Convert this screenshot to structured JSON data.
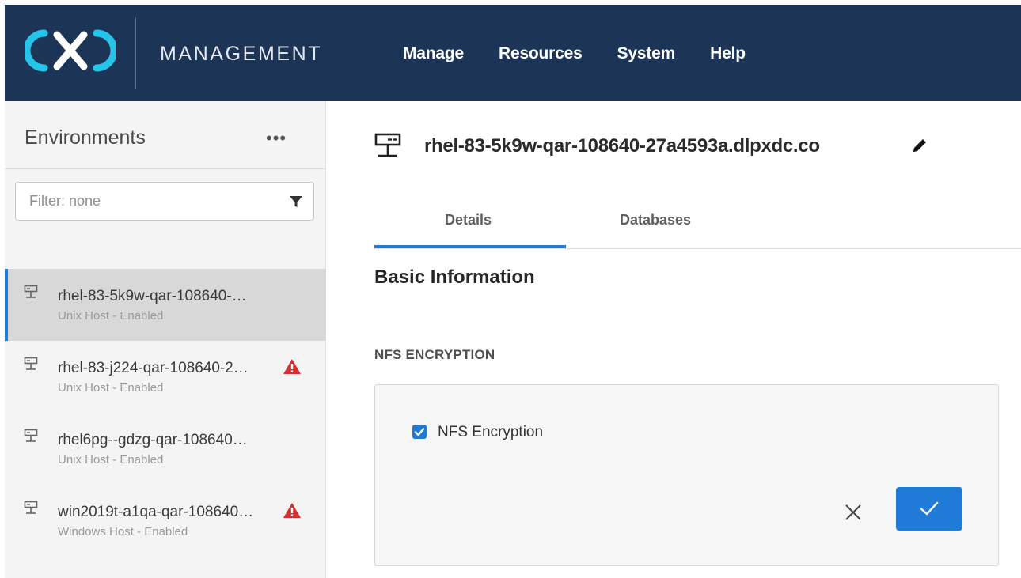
{
  "header": {
    "brand": "MANAGEMENT",
    "nav": [
      "Manage",
      "Resources",
      "System",
      "Help"
    ]
  },
  "sidebar": {
    "title": "Environments",
    "more": "•••",
    "filter_placeholder": "Filter: none",
    "items": [
      {
        "name": "rhel-83-5k9w-qar-108640-…",
        "sub": "Unix Host - Enabled",
        "warning": false,
        "selected": true
      },
      {
        "name": "rhel-83-j224-qar-108640-2…",
        "sub": "Unix Host - Enabled",
        "warning": true,
        "selected": false
      },
      {
        "name": "rhel6pg--gdzg-qar-108640…",
        "sub": "Unix Host - Enabled",
        "warning": false,
        "selected": false
      },
      {
        "name": "win2019t-a1qa-qar-108640…",
        "sub": "Windows Host - Enabled",
        "warning": true,
        "selected": false
      }
    ]
  },
  "main": {
    "host_title": "rhel-83-5k9w-qar-108640-27a4593a.dlpxdc.co",
    "tabs": [
      {
        "label": "Details",
        "active": true
      },
      {
        "label": "Databases",
        "active": false
      }
    ],
    "section_title": "Basic Information",
    "nfs": {
      "label": "NFS ENCRYPTION",
      "checkbox_label": "NFS Encryption",
      "checked": true
    }
  },
  "colors": {
    "header_bg": "#1c3557",
    "accent": "#1f7bd6",
    "logo": "#27c4ea",
    "warning": "#d32f2f"
  }
}
